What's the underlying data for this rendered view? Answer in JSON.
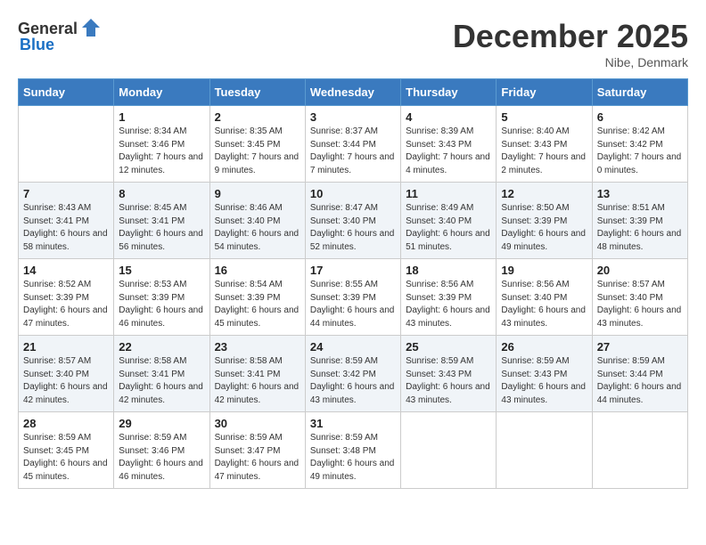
{
  "header": {
    "logo_general": "General",
    "logo_blue": "Blue",
    "title": "December 2025",
    "location": "Nibe, Denmark"
  },
  "weekdays": [
    "Sunday",
    "Monday",
    "Tuesday",
    "Wednesday",
    "Thursday",
    "Friday",
    "Saturday"
  ],
  "weeks": [
    [
      {
        "day": "",
        "sunrise": "",
        "sunset": "",
        "daylight": ""
      },
      {
        "day": "1",
        "sunrise": "Sunrise: 8:34 AM",
        "sunset": "Sunset: 3:46 PM",
        "daylight": "Daylight: 7 hours and 12 minutes."
      },
      {
        "day": "2",
        "sunrise": "Sunrise: 8:35 AM",
        "sunset": "Sunset: 3:45 PM",
        "daylight": "Daylight: 7 hours and 9 minutes."
      },
      {
        "day": "3",
        "sunrise": "Sunrise: 8:37 AM",
        "sunset": "Sunset: 3:44 PM",
        "daylight": "Daylight: 7 hours and 7 minutes."
      },
      {
        "day": "4",
        "sunrise": "Sunrise: 8:39 AM",
        "sunset": "Sunset: 3:43 PM",
        "daylight": "Daylight: 7 hours and 4 minutes."
      },
      {
        "day": "5",
        "sunrise": "Sunrise: 8:40 AM",
        "sunset": "Sunset: 3:43 PM",
        "daylight": "Daylight: 7 hours and 2 minutes."
      },
      {
        "day": "6",
        "sunrise": "Sunrise: 8:42 AM",
        "sunset": "Sunset: 3:42 PM",
        "daylight": "Daylight: 7 hours and 0 minutes."
      }
    ],
    [
      {
        "day": "7",
        "sunrise": "Sunrise: 8:43 AM",
        "sunset": "Sunset: 3:41 PM",
        "daylight": "Daylight: 6 hours and 58 minutes."
      },
      {
        "day": "8",
        "sunrise": "Sunrise: 8:45 AM",
        "sunset": "Sunset: 3:41 PM",
        "daylight": "Daylight: 6 hours and 56 minutes."
      },
      {
        "day": "9",
        "sunrise": "Sunrise: 8:46 AM",
        "sunset": "Sunset: 3:40 PM",
        "daylight": "Daylight: 6 hours and 54 minutes."
      },
      {
        "day": "10",
        "sunrise": "Sunrise: 8:47 AM",
        "sunset": "Sunset: 3:40 PM",
        "daylight": "Daylight: 6 hours and 52 minutes."
      },
      {
        "day": "11",
        "sunrise": "Sunrise: 8:49 AM",
        "sunset": "Sunset: 3:40 PM",
        "daylight": "Daylight: 6 hours and 51 minutes."
      },
      {
        "day": "12",
        "sunrise": "Sunrise: 8:50 AM",
        "sunset": "Sunset: 3:39 PM",
        "daylight": "Daylight: 6 hours and 49 minutes."
      },
      {
        "day": "13",
        "sunrise": "Sunrise: 8:51 AM",
        "sunset": "Sunset: 3:39 PM",
        "daylight": "Daylight: 6 hours and 48 minutes."
      }
    ],
    [
      {
        "day": "14",
        "sunrise": "Sunrise: 8:52 AM",
        "sunset": "Sunset: 3:39 PM",
        "daylight": "Daylight: 6 hours and 47 minutes."
      },
      {
        "day": "15",
        "sunrise": "Sunrise: 8:53 AM",
        "sunset": "Sunset: 3:39 PM",
        "daylight": "Daylight: 6 hours and 46 minutes."
      },
      {
        "day": "16",
        "sunrise": "Sunrise: 8:54 AM",
        "sunset": "Sunset: 3:39 PM",
        "daylight": "Daylight: 6 hours and 45 minutes."
      },
      {
        "day": "17",
        "sunrise": "Sunrise: 8:55 AM",
        "sunset": "Sunset: 3:39 PM",
        "daylight": "Daylight: 6 hours and 44 minutes."
      },
      {
        "day": "18",
        "sunrise": "Sunrise: 8:56 AM",
        "sunset": "Sunset: 3:39 PM",
        "daylight": "Daylight: 6 hours and 43 minutes."
      },
      {
        "day": "19",
        "sunrise": "Sunrise: 8:56 AM",
        "sunset": "Sunset: 3:40 PM",
        "daylight": "Daylight: 6 hours and 43 minutes."
      },
      {
        "day": "20",
        "sunrise": "Sunrise: 8:57 AM",
        "sunset": "Sunset: 3:40 PM",
        "daylight": "Daylight: 6 hours and 43 minutes."
      }
    ],
    [
      {
        "day": "21",
        "sunrise": "Sunrise: 8:57 AM",
        "sunset": "Sunset: 3:40 PM",
        "daylight": "Daylight: 6 hours and 42 minutes."
      },
      {
        "day": "22",
        "sunrise": "Sunrise: 8:58 AM",
        "sunset": "Sunset: 3:41 PM",
        "daylight": "Daylight: 6 hours and 42 minutes."
      },
      {
        "day": "23",
        "sunrise": "Sunrise: 8:58 AM",
        "sunset": "Sunset: 3:41 PM",
        "daylight": "Daylight: 6 hours and 42 minutes."
      },
      {
        "day": "24",
        "sunrise": "Sunrise: 8:59 AM",
        "sunset": "Sunset: 3:42 PM",
        "daylight": "Daylight: 6 hours and 43 minutes."
      },
      {
        "day": "25",
        "sunrise": "Sunrise: 8:59 AM",
        "sunset": "Sunset: 3:43 PM",
        "daylight": "Daylight: 6 hours and 43 minutes."
      },
      {
        "day": "26",
        "sunrise": "Sunrise: 8:59 AM",
        "sunset": "Sunset: 3:43 PM",
        "daylight": "Daylight: 6 hours and 43 minutes."
      },
      {
        "day": "27",
        "sunrise": "Sunrise: 8:59 AM",
        "sunset": "Sunset: 3:44 PM",
        "daylight": "Daylight: 6 hours and 44 minutes."
      }
    ],
    [
      {
        "day": "28",
        "sunrise": "Sunrise: 8:59 AM",
        "sunset": "Sunset: 3:45 PM",
        "daylight": "Daylight: 6 hours and 45 minutes."
      },
      {
        "day": "29",
        "sunrise": "Sunrise: 8:59 AM",
        "sunset": "Sunset: 3:46 PM",
        "daylight": "Daylight: 6 hours and 46 minutes."
      },
      {
        "day": "30",
        "sunrise": "Sunrise: 8:59 AM",
        "sunset": "Sunset: 3:47 PM",
        "daylight": "Daylight: 6 hours and 47 minutes."
      },
      {
        "day": "31",
        "sunrise": "Sunrise: 8:59 AM",
        "sunset": "Sunset: 3:48 PM",
        "daylight": "Daylight: 6 hours and 49 minutes."
      },
      {
        "day": "",
        "sunrise": "",
        "sunset": "",
        "daylight": ""
      },
      {
        "day": "",
        "sunrise": "",
        "sunset": "",
        "daylight": ""
      },
      {
        "day": "",
        "sunrise": "",
        "sunset": "",
        "daylight": ""
      }
    ]
  ]
}
